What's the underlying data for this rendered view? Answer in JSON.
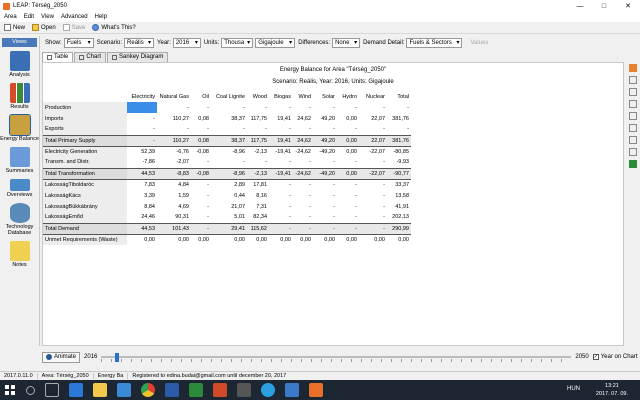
{
  "window": {
    "title": "LEAP: Térség_2050"
  },
  "menu": [
    "Area",
    "Edit",
    "View",
    "Advanced",
    "Help"
  ],
  "toolbar": {
    "new": "New",
    "open": "Open",
    "save": "Save",
    "whats_this": "What's This?"
  },
  "options": {
    "show_label": "Show:",
    "show_value": "Fuels",
    "scenario_label": "Scenario:",
    "scenario_value": "Reális",
    "year_label": "Year:",
    "year_value": "2016",
    "units_label": "Units:",
    "units_value": "Thousa",
    "units_value2": "Gigajoule",
    "diff_label": "Differences:",
    "diff_value": "None",
    "demand_label": "Demand Detail:",
    "demand_value": "Fuels & Sectors",
    "values_label": "Values"
  },
  "sidebar": {
    "header": "Views",
    "items": [
      {
        "label": "Analysis",
        "color": "#3a6fb5"
      },
      {
        "label": "Results",
        "color": "#d64a2a"
      },
      {
        "label": "Energy Balance",
        "color": "#c8a040"
      },
      {
        "label": "Summaries",
        "color": "#6a9ad8"
      },
      {
        "label": "Overviews",
        "color": "#4a8ac8"
      },
      {
        "label": "Technology Database",
        "color": "#5a8ab8"
      },
      {
        "label": "Notes",
        "color": "#f0d050"
      }
    ]
  },
  "tabs": [
    {
      "label": "Table"
    },
    {
      "label": "Chart"
    },
    {
      "label": "Sankey Diagram"
    }
  ],
  "report": {
    "title": "Energy Balance for Area \"Térség_2050\"",
    "subtitle": "Scenario: Reális, Year: 2016, Units: Gigajoule",
    "columns": [
      "Electricity",
      "Natural Gas",
      "Oil",
      "Coal Lignite",
      "Wood",
      "Biogas",
      "Wind",
      "Solar",
      "Hydro",
      "Nuclear",
      "Total"
    ],
    "rows": [
      {
        "label": "Production",
        "values": [
          "",
          "-",
          "-",
          "-",
          "-",
          "-",
          "-",
          "-",
          "-",
          "-",
          "-"
        ],
        "sep": false,
        "total": false
      },
      {
        "label": "Imports",
        "values": [
          "-",
          "110,27",
          "0,08",
          "38,37",
          "117,75",
          "19,41",
          "24,62",
          "49,20",
          "0,00",
          "22,07",
          "381,76"
        ],
        "sep": false,
        "total": false
      },
      {
        "label": "Exports",
        "values": [
          "-",
          "-",
          "-",
          "-",
          "-",
          "-",
          "-",
          "-",
          "-",
          "-",
          "-"
        ],
        "sep": false,
        "total": false
      },
      {
        "label": "Total Primary Supply",
        "values": [
          "-",
          "110,27",
          "0,08",
          "38,37",
          "117,75",
          "19,41",
          "24,62",
          "49,20",
          "0,00",
          "22,07",
          "381,76"
        ],
        "sep": true,
        "total": true
      },
      {
        "label": "Electricity Generation",
        "values": [
          "52,39",
          "-6,76",
          "-0,08",
          "-8,96",
          "-2,13",
          "-19,41",
          "-24,62",
          "-49,20",
          "0,00",
          "-22,07",
          "-80,85"
        ],
        "sep": true,
        "total": false
      },
      {
        "label": "Transm. and Distr.",
        "values": [
          "-7,86",
          "-2,07",
          "-",
          "-",
          "-",
          "-",
          "-",
          "-",
          "-",
          "-",
          "-9,93"
        ],
        "sep": false,
        "total": false
      },
      {
        "label": "Total Transformation",
        "values": [
          "44,53",
          "-8,83",
          "-0,08",
          "-8,96",
          "-2,13",
          "-19,41",
          "-24,62",
          "-49,20",
          "0,00",
          "-22,07",
          "-90,77"
        ],
        "sep": true,
        "total": true
      },
      {
        "label": "LakosságTiboldaróc",
        "values": [
          "7,83",
          "4,84",
          "-",
          "2,89",
          "17,81",
          "-",
          "-",
          "-",
          "-",
          "-",
          "33,37"
        ],
        "sep": true,
        "total": false
      },
      {
        "label": "LakosságKács",
        "values": [
          "3,39",
          "1,59",
          "-",
          "0,44",
          "8,16",
          "-",
          "-",
          "-",
          "-",
          "-",
          "13,58"
        ],
        "sep": false,
        "total": false
      },
      {
        "label": "LakosságBükkábrány",
        "values": [
          "8,84",
          "4,69",
          "-",
          "21,07",
          "7,31",
          "-",
          "-",
          "-",
          "-",
          "-",
          "41,91"
        ],
        "sep": false,
        "total": false
      },
      {
        "label": "LakosságEmőd",
        "values": [
          "24,46",
          "90,31",
          "-",
          "5,01",
          "82,34",
          "-",
          "-",
          "-",
          "-",
          "-",
          "202,13"
        ],
        "sep": false,
        "total": false
      },
      {
        "label": "Total Demand",
        "values": [
          "44,53",
          "101,43",
          "-",
          "29,41",
          "115,62",
          "-",
          "-",
          "-",
          "-",
          "-",
          "290,99"
        ],
        "sep": true,
        "total": true
      },
      {
        "label": "Unmet Requirements (Waste)",
        "values": [
          "0,00",
          "0,00",
          "0,00",
          "0,00",
          "0,00",
          "0,00",
          "0,00",
          "0,00",
          "0,00",
          "0,00",
          "0,00"
        ],
        "sep": true,
        "total": false
      }
    ]
  },
  "animate": {
    "button": "Animate",
    "start_year": "2016",
    "end_year": "2050",
    "checkbox": "Year on Chart",
    "checked": true,
    "position": 0.03
  },
  "status": {
    "version": "2017.0.11.0",
    "area": "Area: Térség_2050",
    "view": "Energy Ba",
    "registration": "Registered to edina.budai@gmail.com until december 20, 2017"
  },
  "taskbar": {
    "time": "13:21",
    "date": "2017. 07. 09.",
    "lang": "HUN"
  }
}
